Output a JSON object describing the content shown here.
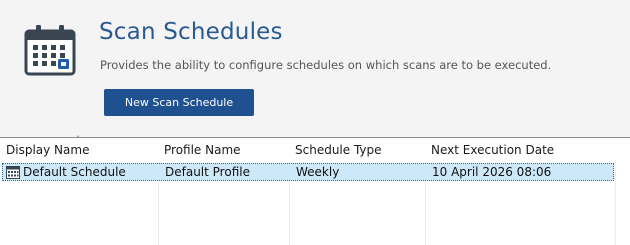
{
  "header": {
    "icon": "calendar-icon",
    "title": "Scan Schedules",
    "subtitle": "Provides the ability to configure schedules on which scans are to be executed.",
    "new_button_label": "New Scan Schedule"
  },
  "colors": {
    "title": "#2a5a8f",
    "button_bg": "#1f5190",
    "icon": "#3a4552",
    "icon_accent": "#1f5ea8",
    "selected_row": "#cde8f8"
  },
  "table": {
    "sorted_column": "Display Name",
    "sort_direction": "ascending",
    "columns": [
      "Display Name",
      "Profile Name",
      "Schedule Type",
      "Next Execution Date"
    ],
    "rows": [
      {
        "icon": "calendar-small-icon",
        "display_name": "Default Schedule",
        "profile_name": "Default Profile",
        "schedule_type": "Weekly",
        "next_execution": "10 April 2026 08:06",
        "selected": true
      }
    ]
  }
}
